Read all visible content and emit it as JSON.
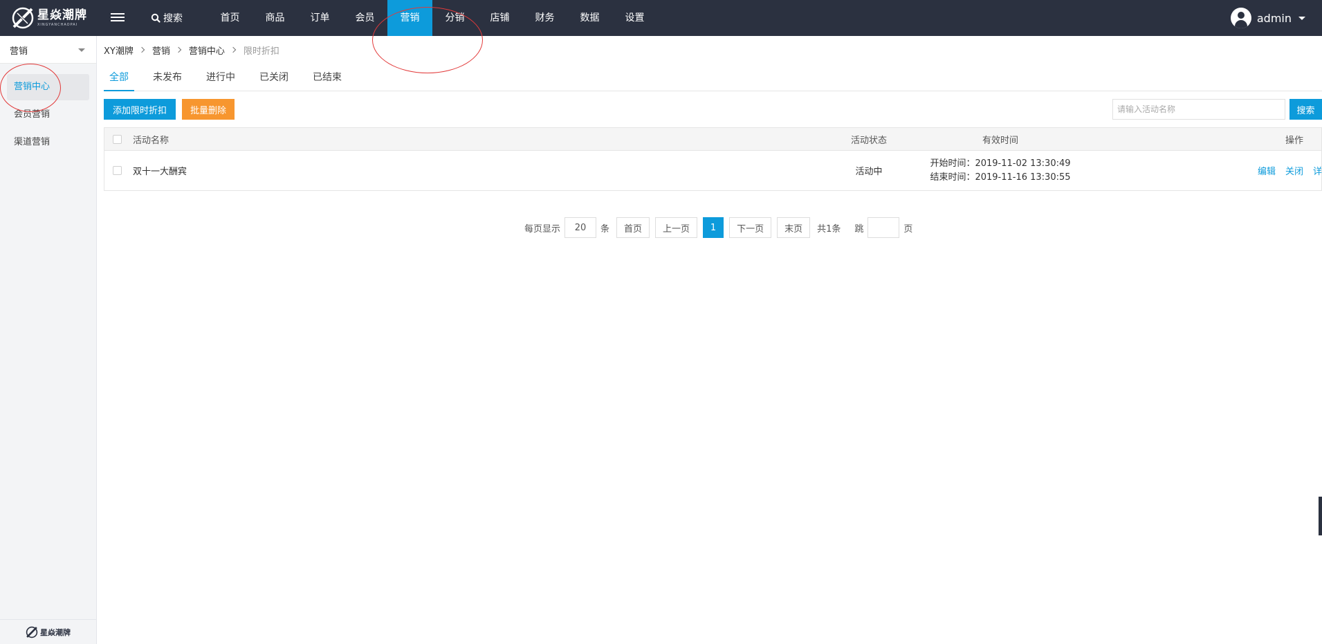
{
  "header": {
    "logo_text": "星焱潮牌",
    "logo_sub": "XINGYANCHAOPAI",
    "search_label": "搜索",
    "nav": [
      "首页",
      "商品",
      "订单",
      "会员",
      "营销",
      "分销",
      "店铺",
      "财务",
      "数据",
      "设置"
    ],
    "active_nav": "营销",
    "user_name": "admin"
  },
  "sidebar": {
    "title": "营销",
    "items": [
      {
        "label": "营销中心",
        "active": true
      },
      {
        "label": "会员营销",
        "active": false
      },
      {
        "label": "渠道营销",
        "active": false
      }
    ],
    "footer_logo": "星焱潮牌"
  },
  "breadcrumb": [
    "XY潮牌",
    "营销",
    "营销中心",
    "限时折扣"
  ],
  "tabs": [
    "全部",
    "未发布",
    "进行中",
    "已关闭",
    "已结束"
  ],
  "active_tab": "全部",
  "toolbar": {
    "add_label": "添加限时折扣",
    "batch_delete_label": "批量删除",
    "search_placeholder": "请输入活动名称",
    "search_button": "搜索"
  },
  "table": {
    "headers": {
      "name": "活动名称",
      "status": "活动状态",
      "time": "有效时间",
      "ops": "操作"
    },
    "rows": [
      {
        "name": "双十一大酬宾",
        "status": "活动中",
        "start": "开始时间：2019-11-02 13:30:49",
        "end": "结束时间：2019-11-16 13:30:55",
        "ops": [
          "编辑",
          "关闭",
          "详情"
        ]
      }
    ]
  },
  "pagination": {
    "per_page_label": "每页显示",
    "per_page": "20",
    "unit": "条",
    "first": "首页",
    "prev": "上一页",
    "current": "1",
    "next": "下一页",
    "last": "末页",
    "total": "共1条",
    "jump_label": "跳",
    "page_unit": "页"
  },
  "colors": {
    "topbar": "#2b3140",
    "accent": "#0d9bdb",
    "warning": "#f7962f",
    "annotation": "#e23a3a"
  }
}
